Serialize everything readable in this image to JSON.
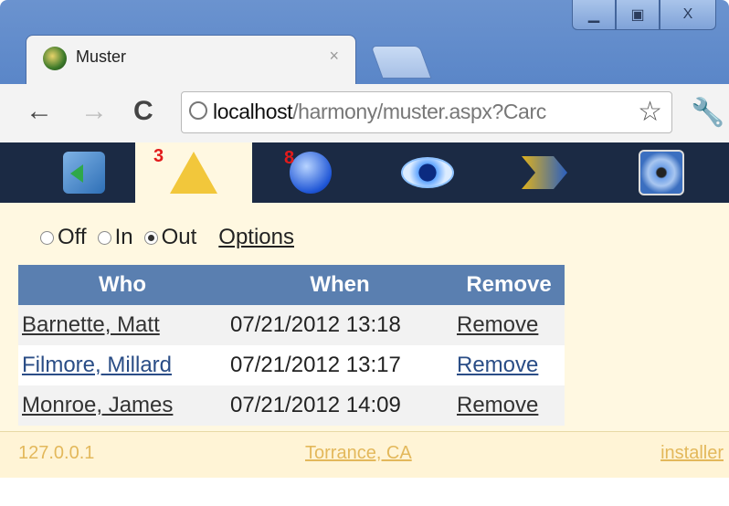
{
  "browser": {
    "tab_title": "Muster",
    "tab_close": "×",
    "url_host": "localhost",
    "url_path": "/harmony/muster.aspx?Carc",
    "back": "←",
    "forward": "→",
    "reload": "C",
    "star": "☆",
    "wrench": "🔧",
    "min": "▁",
    "max": "▣",
    "close": "X"
  },
  "appnav": {
    "items": [
      {
        "name": "user-nav-icon",
        "badge": ""
      },
      {
        "name": "warning-nav-icon",
        "badge": "3"
      },
      {
        "name": "alert-nav-icon",
        "badge": "8"
      },
      {
        "name": "eye-nav-icon",
        "badge": ""
      },
      {
        "name": "arrows-nav-icon",
        "badge": ""
      },
      {
        "name": "disc-nav-icon",
        "badge": ""
      }
    ],
    "active_index": 1
  },
  "filter": {
    "options": [
      "Off",
      "In",
      "Out"
    ],
    "selected": "Out",
    "options_link": "Options"
  },
  "table": {
    "headers": [
      "Who",
      "When",
      "Remove"
    ],
    "rows": [
      {
        "who": "Barnette, Matt",
        "when": "07/21/2012 13:18",
        "remove": "Remove"
      },
      {
        "who": "Filmore, Millard",
        "when": "07/21/2012 13:17",
        "remove": "Remove"
      },
      {
        "who": "Monroe, James",
        "when": "07/21/2012 14:09",
        "remove": "Remove"
      }
    ]
  },
  "footer": {
    "ip": "127.0.0.1",
    "location": "Torrance, CA",
    "user": "installer"
  },
  "colors": {
    "nav_bg": "#1b2a44",
    "content_bg": "#fff8e1",
    "header_bg": "#5a7fb0",
    "footer_text": "#e3b85b"
  }
}
